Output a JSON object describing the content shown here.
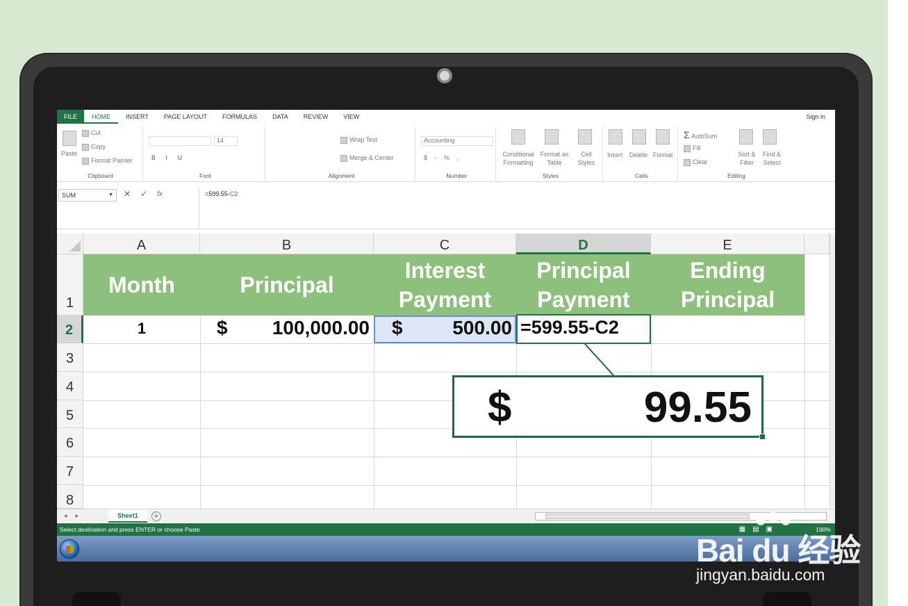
{
  "ribbon": {
    "tabs": [
      "FILE",
      "HOME",
      "INSERT",
      "PAGE LAYOUT",
      "FORMULAS",
      "DATA",
      "REVIEW",
      "VIEW"
    ],
    "signin": "Sign in",
    "clipboard": {
      "paste": "Paste",
      "cut": "Cut",
      "copy": "Copy",
      "format_painter": "Format Painter",
      "label": "Clipboard"
    },
    "font": {
      "size": "14",
      "label": "Font"
    },
    "alignment": {
      "wrap": "Wrap Text",
      "merge": "Merge & Center",
      "label": "Alignment"
    },
    "number": {
      "format": "Accounting",
      "label": "Number"
    },
    "styles": {
      "conditional": "Conditional Formatting",
      "format_table": "Format as Table",
      "cell_styles": "Cell Styles",
      "label": "Styles"
    },
    "cells": {
      "insert": "Insert",
      "delete": "Delete",
      "format": "Format",
      "label": "Cells"
    },
    "editing": {
      "autosum": "AutoSum",
      "fill": "Fill",
      "clear": "Clear",
      "sort": "Sort & Filter",
      "find": "Find & Select",
      "label": "Editing"
    }
  },
  "formula_bar": {
    "name_box": "SUM",
    "formula_prefix": "=599.55-",
    "formula_ref": "C2",
    "fx": "fx"
  },
  "grid": {
    "columns": [
      "A",
      "B",
      "C",
      "D",
      "E"
    ],
    "rows": [
      "1",
      "2",
      "3",
      "4",
      "5",
      "6",
      "7",
      "8"
    ],
    "headers": {
      "a": "Month",
      "b": "Principal",
      "c": "Interest Payment",
      "d": "Principal Payment",
      "e": "Ending Principal"
    },
    "row2": {
      "a": "1",
      "b_cur": "$",
      "b_val": "100,000.00",
      "c_cur": "$",
      "c_val": "500.00",
      "d": "=599.55-C2"
    }
  },
  "callout": {
    "currency": "$",
    "amount": "99.55"
  },
  "sheet": {
    "tab": "Sheet1"
  },
  "status": {
    "message": "Select destination and press ENTER or choose Paste",
    "zoom": "190%"
  },
  "watermark": {
    "logo": "Bai du 经验",
    "url": "jingyan.baidu.com"
  },
  "colors": {
    "excel_green": "#217346",
    "header_band": "#8dc07c",
    "background": "#d7e9d0"
  }
}
